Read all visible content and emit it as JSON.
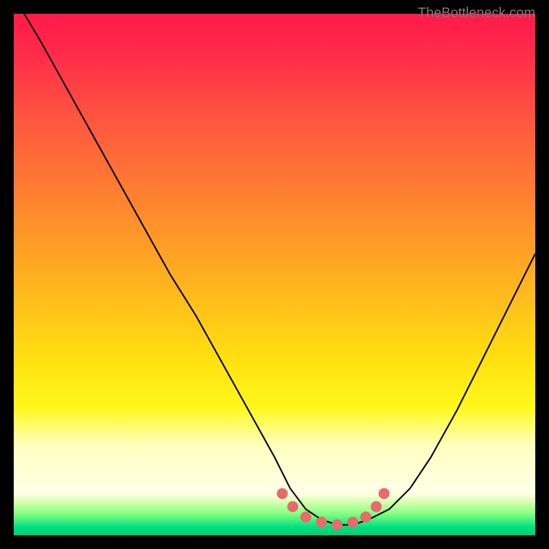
{
  "watermark": "TheBottleneck.com",
  "chart_data": {
    "type": "line",
    "title": "",
    "xlabel": "",
    "ylabel": "",
    "xlim": [
      0,
      100
    ],
    "ylim": [
      0,
      100
    ],
    "series": [
      {
        "name": "bottleneck-curve",
        "x": [
          0,
          2,
          5,
          10,
          15,
          20,
          25,
          30,
          35,
          40,
          45,
          50,
          53,
          56,
          59,
          62,
          65,
          68,
          72,
          76,
          80,
          85,
          90,
          95,
          100
        ],
        "y": [
          105,
          100,
          95,
          86,
          77,
          68,
          59,
          50,
          42,
          33,
          24,
          15,
          9,
          5,
          3,
          2,
          2,
          3,
          5,
          9,
          15,
          24,
          34,
          44,
          54
        ]
      }
    ],
    "markers": {
      "name": "highlight-dots",
      "x": [
        51.5,
        53.5,
        56,
        59,
        62,
        65,
        67.5,
        69.5,
        71
      ],
      "y": [
        8,
        5.5,
        3.5,
        2.5,
        2,
        2.5,
        3.5,
        5.5,
        8
      ]
    },
    "gradient_stops": [
      {
        "pos": 0.0,
        "color": "#ff1a4a"
      },
      {
        "pos": 0.2,
        "color": "#ff5640"
      },
      {
        "pos": 0.45,
        "color": "#ffb020"
      },
      {
        "pos": 0.7,
        "color": "#ffe010"
      },
      {
        "pos": 0.88,
        "color": "#ffffc0"
      },
      {
        "pos": 0.94,
        "color": "#80ff80"
      },
      {
        "pos": 1.0,
        "color": "#00d070"
      }
    ]
  }
}
